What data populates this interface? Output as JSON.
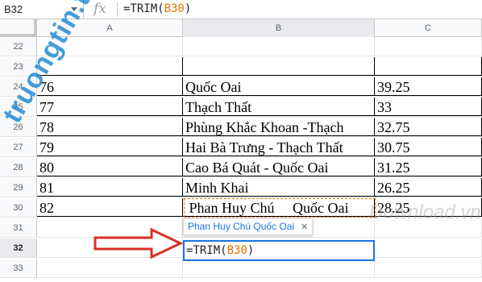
{
  "formula_bar": {
    "name_box": "B32",
    "fx_label": "fx",
    "formula_prefix": "=TRIM(",
    "formula_ref": "B30",
    "formula_suffix": ")"
  },
  "columns": [
    "A",
    "B",
    "C"
  ],
  "rows": [
    {
      "num": "22",
      "a": "",
      "b": "",
      "c": "",
      "bordered": false
    },
    {
      "num": "23",
      "a": "",
      "b": "",
      "c": "",
      "bordered": true
    },
    {
      "num": "24",
      "a": "76",
      "b": "Quốc Oai",
      "c": "39.25",
      "bordered": true
    },
    {
      "num": "25",
      "a": "77",
      "b": "Thạch Thất",
      "c": "33",
      "bordered": true
    },
    {
      "num": "26",
      "a": "78",
      "b": "Phùng Khắc Khoan -Thạch",
      "c": "32.75",
      "bordered": true
    },
    {
      "num": "27",
      "a": "79",
      "b": "Hai Bà Trưng - Thạch Thất",
      "c": "30.75",
      "bordered": true
    },
    {
      "num": "28",
      "a": "80",
      "b": "Cao Bá Quát - Quốc Oai",
      "c": "31.25",
      "bordered": true
    },
    {
      "num": "29",
      "a": "81",
      "b": "Minh Khai",
      "c": "26.25",
      "bordered": true
    },
    {
      "num": "30",
      "a": "82",
      "b": " Phan Huy Chú     Quốc Oai",
      "c": "28.25",
      "bordered": true
    },
    {
      "num": "31",
      "a": "",
      "b": "",
      "c": "",
      "bordered": false
    },
    {
      "num": "32",
      "a": "",
      "b": "",
      "c": "",
      "bordered": false
    },
    {
      "num": "33",
      "a": "",
      "b": "",
      "c": "",
      "bordered": false
    }
  ],
  "preview": {
    "text": "Phan Huy Chú Quốc Oai",
    "close_glyph": "✕"
  },
  "active_cell": {
    "prefix": "=TRIM(",
    "ref": "B30",
    "suffix": ")"
  },
  "watermark": {
    "left": "truongtin.top",
    "right": "Download.vn"
  },
  "colors": {
    "ref": "#e37400",
    "active": "#1a73e8",
    "arrow": "#d93025",
    "watermark": "#258cd2"
  }
}
